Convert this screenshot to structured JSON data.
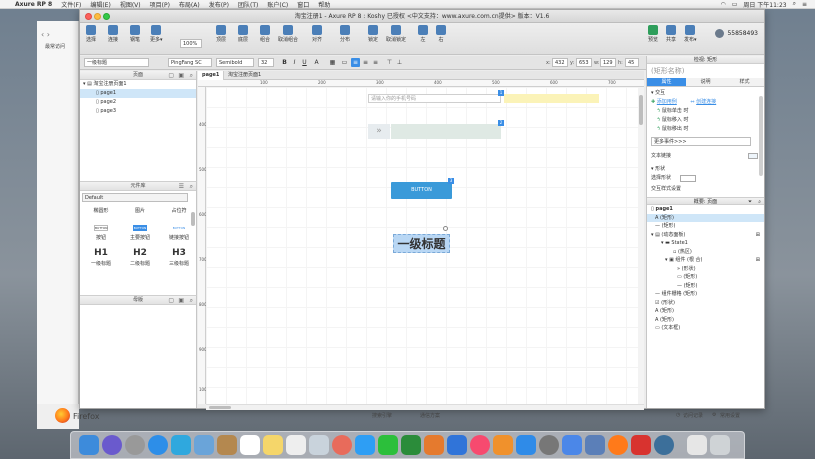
{
  "menubar": {
    "app": "Axure RP 8",
    "items": [
      "文件(F)",
      "编辑(E)",
      "视图(V)",
      "项目(P)",
      "布局(A)",
      "发布(P)",
      "团队(T)",
      "账户(C)",
      "窗口",
      "帮助"
    ],
    "clock": "周日 下午11:23"
  },
  "browser": {
    "bookmark": "最常访问",
    "firefox_label": "Firefox"
  },
  "window": {
    "title": "淘宝注册1 - Axure RP 8 : Koshy 已授权   <中文支持：www.axure.com.cn提供> 版本：V1.6"
  },
  "toolbar": {
    "buttons": [
      "选择",
      "连接",
      "钢笔",
      "更多▾",
      "缩放",
      "顶层",
      "底层",
      "组合",
      "取消组合",
      "对齐",
      "分布",
      "锁定",
      "取消锁定",
      "左",
      "右",
      "预览",
      "共享",
      "发布▾"
    ],
    "zoom": "100%",
    "user": "55858493"
  },
  "format": {
    "style": "一级标题",
    "font": "PingFang SC",
    "weight": "Semibold",
    "size": "32",
    "x_label": "x:",
    "x": "432",
    "y_label": "y:",
    "y": "653",
    "w_label": "w:",
    "w": "129",
    "h_label": "h:",
    "h": "45"
  },
  "pages": {
    "header": "页面",
    "root": "淘宝注册页面1",
    "items": [
      "page1",
      "page2",
      "page3"
    ]
  },
  "library": {
    "header": "元件库",
    "dropdown": "Default",
    "row1": [
      "椭圆形",
      "图片",
      "占位符"
    ],
    "row2": [
      "按钮",
      "主要按钮",
      "链接按钮"
    ],
    "row2_thumbs": [
      "BUTTON",
      "BUTTON",
      "BUTTON"
    ],
    "row3_big": [
      "H1",
      "H2",
      "H3"
    ],
    "row3": [
      "一级标题",
      "二级标题",
      "三级标题"
    ]
  },
  "masters": {
    "header": "母版"
  },
  "tabs": [
    "page1",
    "淘宝注册页面1"
  ],
  "ruler": {
    "h": [
      "100",
      "200",
      "300",
      "400",
      "500",
      "600",
      "700"
    ],
    "v": [
      "400",
      "500",
      "600",
      "700",
      "800",
      "900",
      "1000"
    ]
  },
  "canvas": {
    "input_placeholder": "请输入你的手机号码",
    "badge1": "1",
    "badge2": "2",
    "badge3": "3",
    "button_label": "BUTTON",
    "heading": "一级标题"
  },
  "inspector": {
    "header": "检视: 矩形",
    "name_placeholder": "(矩形名称)",
    "tabs": [
      "属性",
      "说明",
      "样式"
    ],
    "interaction": "交互",
    "add_case": "添加用例",
    "create_link": "创建连接",
    "events": [
      "鼠标单击 时",
      "鼠标移入 时",
      "鼠标移出 时"
    ],
    "more_events": "更多事件>>>",
    "text_link": "文本链接",
    "shape": "形状",
    "select_shape": "选择形状",
    "interaction_style": "交互样式设置"
  },
  "outline": {
    "header": "概要: 页面",
    "rows": [
      "page1",
      "(矩形)",
      "(矩形)",
      "(动态面板)",
      "State1",
      "(热区)",
      "组件 (根 合)",
      "(形状)",
      "(矩形)",
      "(矩形)",
      "组件栅格 (矩形)",
      "(形状)",
      "(矩形)",
      "(矩形)",
      "(文本框)"
    ]
  },
  "bottom": {
    "left": [
      "搜索引擎",
      "通信方案"
    ],
    "right": [
      "访问记录",
      "常用设置"
    ]
  },
  "colors": {
    "accent": "#3a8ee6",
    "button": "#3a9ad9",
    "heading_bg": "#b9d7f4",
    "banner": "#dfe9e4",
    "yellow": "#fbf3b8"
  }
}
